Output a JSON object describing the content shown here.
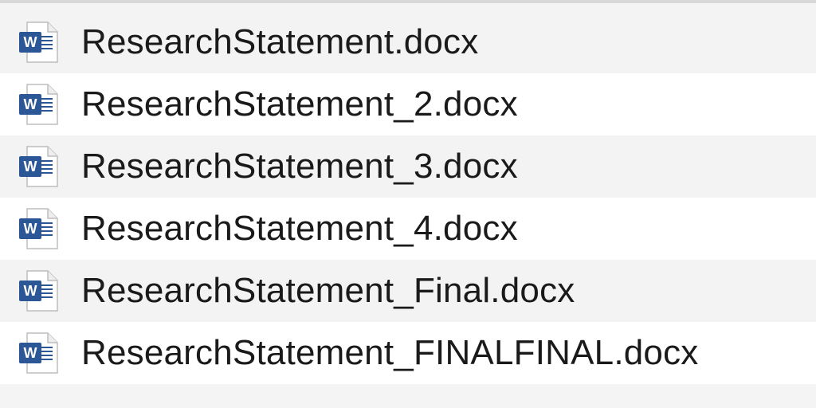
{
  "files": [
    {
      "name": "ResearchStatement.docx",
      "icon": "word-document-icon"
    },
    {
      "name": "ResearchStatement_2.docx",
      "icon": "word-document-icon"
    },
    {
      "name": "ResearchStatement_3.docx",
      "icon": "word-document-icon"
    },
    {
      "name": "ResearchStatement_4.docx",
      "icon": "word-document-icon"
    },
    {
      "name": "ResearchStatement_Final.docx",
      "icon": "word-document-icon"
    },
    {
      "name": "ResearchStatement_FINALFINAL.docx",
      "icon": "word-document-icon"
    }
  ],
  "colors": {
    "word_blue": "#2b5797",
    "row_alt": "#f3f3f3",
    "row_plain": "#ffffff"
  }
}
